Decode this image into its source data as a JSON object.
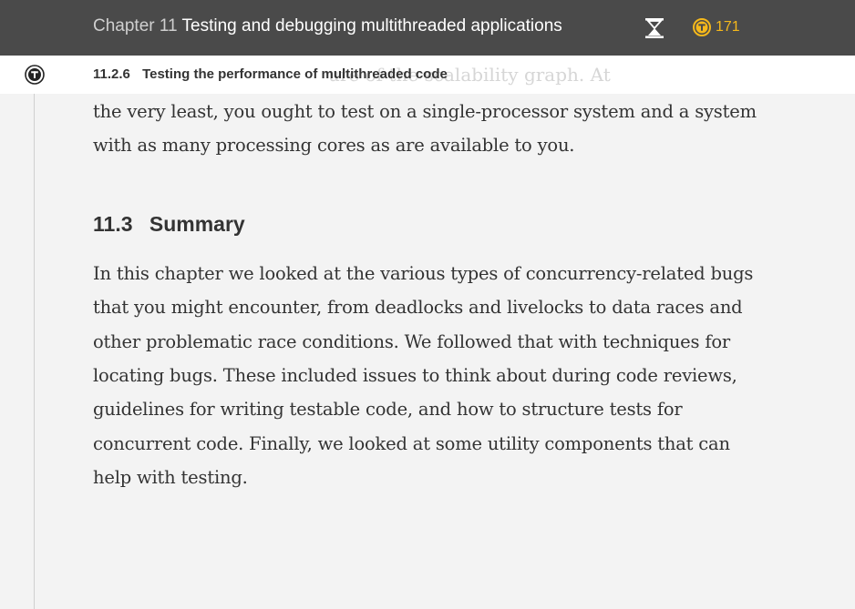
{
  "header": {
    "chapter_number": "Chapter 11",
    "chapter_title": "Testing and debugging multithreaded applications",
    "token_count": "171",
    "token_color": "#f5b81b",
    "icons": [
      "hourglass-icon",
      "token-icon",
      "toc-icon"
    ]
  },
  "subheader": {
    "section_number": "11.2.6",
    "section_title": "Testing the performance of multithreaded code",
    "ghost_text": "ure of the scalability graph. At"
  },
  "content": {
    "intro_lines": [
      "the very least, you ought to test on a single-processor system and a system",
      "with as many processing cores as are available to you."
    ],
    "heading_number": "11.3",
    "heading_title": "Summary",
    "summary_lines": [
      "In this chapter we looked at the various types of concurrency-related bugs",
      "that you might encounter, from deadlocks and livelocks to data races and",
      "other problematic race conditions. We followed that with techniques for",
      "locating bugs. These included issues to think about during code reviews,",
      "guidelines for writing testable code, and how to structure tests for",
      "concurrent code. Finally, we looked at some utility components that can",
      "help with testing."
    ]
  }
}
